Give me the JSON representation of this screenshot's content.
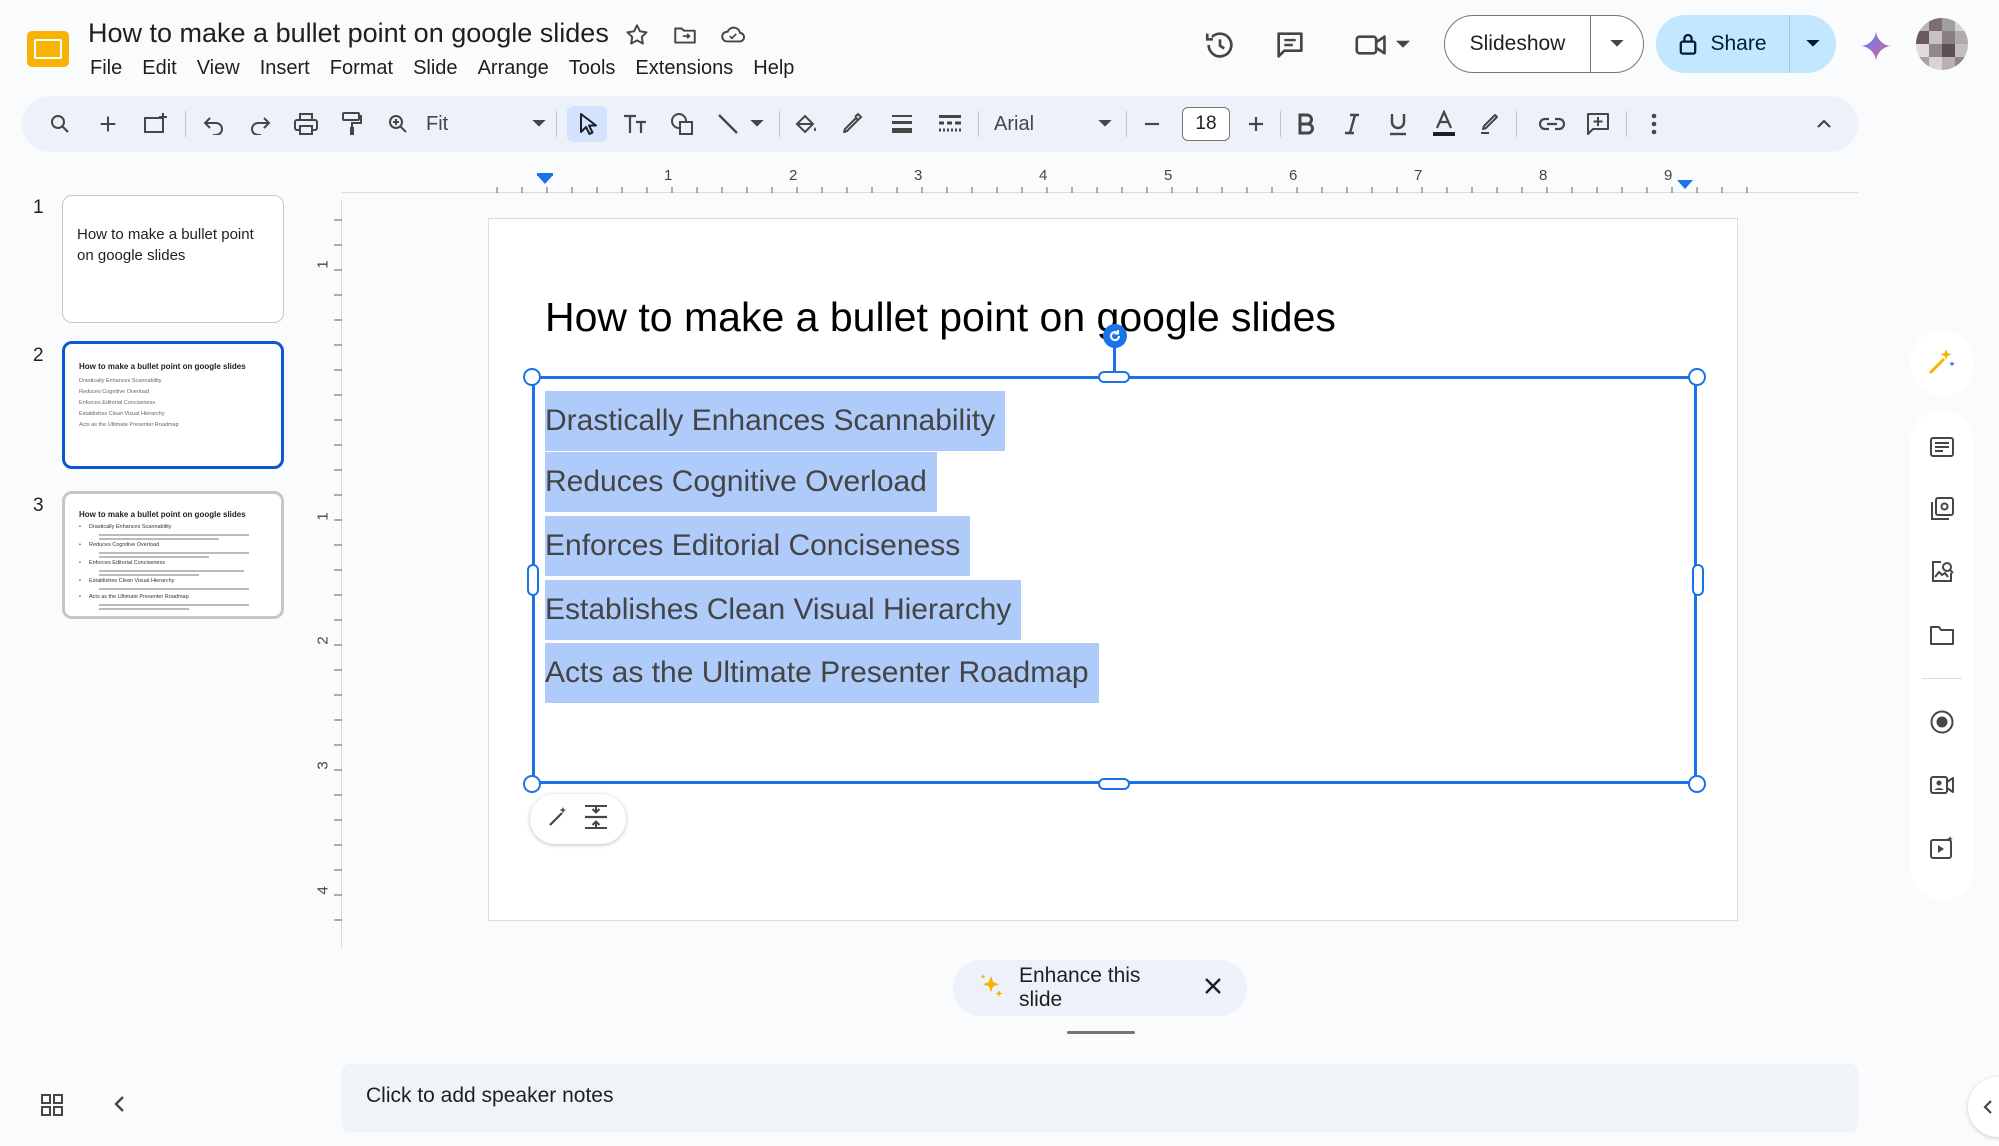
{
  "header": {
    "doc_title": "How to make a bullet point on google slides",
    "menu": [
      "File",
      "Edit",
      "View",
      "Insert",
      "Format",
      "Slide",
      "Arrange",
      "Tools",
      "Extensions",
      "Help"
    ],
    "slideshow_label": "Slideshow",
    "share_label": "Share"
  },
  "toolbar": {
    "zoom_label": "Fit",
    "font_name": "Arial",
    "font_size": "18"
  },
  "ruler": {
    "h_numbers": [
      "1",
      "2",
      "3",
      "4",
      "5",
      "6",
      "7",
      "8",
      "9"
    ],
    "v_numbers": [
      "1",
      "1",
      "2",
      "3",
      "4"
    ]
  },
  "filmstrip": {
    "slides": [
      {
        "number": "1",
        "title": "How to make a bullet point on google slides"
      },
      {
        "number": "2",
        "title": "How to make a bullet point on google slides",
        "lines": [
          "Drastically Enhances Scannability",
          "Reduces Cognitive Overload",
          "Enforces Editorial Conciseness",
          "Establishes Clean Visual Hierarchy",
          "Acts as the Ultimate Presenter Roadmap"
        ]
      },
      {
        "number": "3",
        "title": "How to make a bullet point on google slides",
        "bullets": [
          "Drastically Enhances Scannability",
          "Reduces Cognitive Overload",
          "Enforces Editorial Conciseness",
          "Establishes Clean Visual Hierarchy",
          "Acts as the Ultimate Presenter Roadmap"
        ]
      }
    ]
  },
  "slide": {
    "title": "How to make a bullet point on google slides",
    "selected_lines": [
      "Drastically Enhances Scannability",
      "Reduces Cognitive Overload",
      "Enforces Editorial Conciseness",
      "Establishes Clean Visual Hierarchy",
      "Acts as the Ultimate Presenter Roadmap"
    ]
  },
  "bottom": {
    "enhance_label": "Enhance this slide",
    "notes_placeholder": "Click to add speaker notes"
  },
  "colors": {
    "accent": "#1a73e8",
    "selection": "#aecbfa",
    "share_bg": "#c2e7ff",
    "toolbar_bg": "#edf2fa"
  }
}
